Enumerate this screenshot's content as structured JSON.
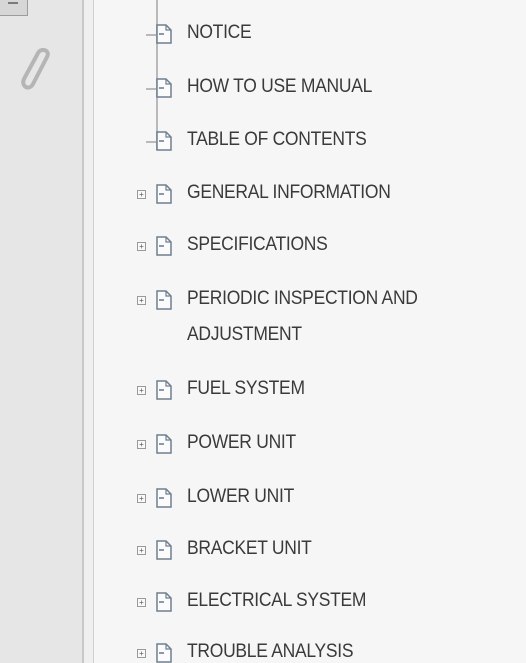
{
  "rail": {
    "tab_icon": "collapse-tab-icon",
    "attachment_icon": "paperclip-icon"
  },
  "bookmarks": {
    "items": [
      {
        "label": "NOTICE",
        "expandable": false,
        "icon": "bookmark-page-icon"
      },
      {
        "label": "HOW TO USE MANUAL",
        "expandable": false,
        "icon": "bookmark-page-icon"
      },
      {
        "label": "TABLE OF CONTENTS",
        "expandable": false,
        "icon": "bookmark-page-icon"
      },
      {
        "label": "GENERAL INFORMATION",
        "expandable": true,
        "icon": "bookmark-page-icon"
      },
      {
        "label": "SPECIFICATIONS",
        "expandable": true,
        "icon": "bookmark-page-icon"
      },
      {
        "label": "PERIODIC INSPECTION AND ADJUSTMENT",
        "expandable": true,
        "icon": "bookmark-page-icon"
      },
      {
        "label": "FUEL SYSTEM",
        "expandable": true,
        "icon": "bookmark-page-icon"
      },
      {
        "label": "POWER UNIT",
        "expandable": true,
        "icon": "bookmark-page-icon"
      },
      {
        "label": "LOWER UNIT",
        "expandable": true,
        "icon": "bookmark-page-icon"
      },
      {
        "label": "BRACKET UNIT",
        "expandable": true,
        "icon": "bookmark-page-icon"
      },
      {
        "label": "ELECTRICAL SYSTEM",
        "expandable": true,
        "icon": "bookmark-page-icon"
      },
      {
        "label": "TROUBLE ANALYSIS",
        "expandable": true,
        "icon": "bookmark-page-icon"
      }
    ]
  },
  "colors": {
    "panel_bg": "#f6f6f6",
    "rail_bg": "#e6e6e6",
    "text": "#3a3a3a",
    "tree_line": "#b9b9b9"
  }
}
